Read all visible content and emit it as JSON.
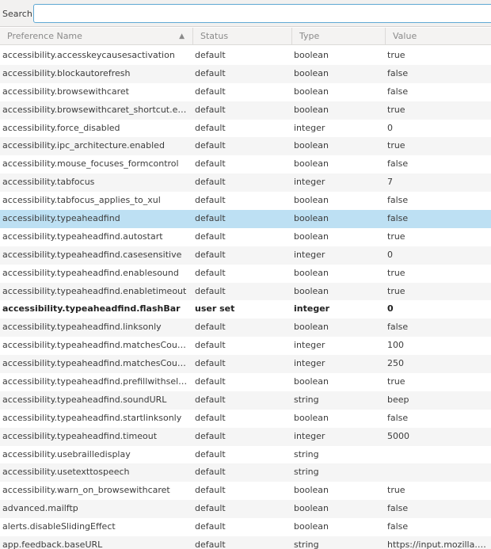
{
  "search": {
    "label": "Search:",
    "value": "",
    "placeholder": ""
  },
  "columns": {
    "name": "Preference Name",
    "status": "Status",
    "type": "Type",
    "value": "Value"
  },
  "rows": [
    {
      "name": "accessibility.accesskeycausesactivation",
      "status": "default",
      "type": "boolean",
      "value": "true"
    },
    {
      "name": "accessibility.blockautorefresh",
      "status": "default",
      "type": "boolean",
      "value": "false"
    },
    {
      "name": "accessibility.browsewithcaret",
      "status": "default",
      "type": "boolean",
      "value": "false"
    },
    {
      "name": "accessibility.browsewithcaret_shortcut.enabled",
      "status": "default",
      "type": "boolean",
      "value": "true"
    },
    {
      "name": "accessibility.force_disabled",
      "status": "default",
      "type": "integer",
      "value": "0"
    },
    {
      "name": "accessibility.ipc_architecture.enabled",
      "status": "default",
      "type": "boolean",
      "value": "true"
    },
    {
      "name": "accessibility.mouse_focuses_formcontrol",
      "status": "default",
      "type": "boolean",
      "value": "false"
    },
    {
      "name": "accessibility.tabfocus",
      "status": "default",
      "type": "integer",
      "value": "7"
    },
    {
      "name": "accessibility.tabfocus_applies_to_xul",
      "status": "default",
      "type": "boolean",
      "value": "false"
    },
    {
      "name": "accessibility.typeaheadfind",
      "status": "default",
      "type": "boolean",
      "value": "false"
    },
    {
      "name": "accessibility.typeaheadfind.autostart",
      "status": "default",
      "type": "boolean",
      "value": "true"
    },
    {
      "name": "accessibility.typeaheadfind.casesensitive",
      "status": "default",
      "type": "integer",
      "value": "0"
    },
    {
      "name": "accessibility.typeaheadfind.enablesound",
      "status": "default",
      "type": "boolean",
      "value": "true"
    },
    {
      "name": "accessibility.typeaheadfind.enabletimeout",
      "status": "default",
      "type": "boolean",
      "value": "true"
    },
    {
      "name": "accessibility.typeaheadfind.flashBar",
      "status": "user set",
      "type": "integer",
      "value": "0"
    },
    {
      "name": "accessibility.typeaheadfind.linksonly",
      "status": "default",
      "type": "boolean",
      "value": "false"
    },
    {
      "name": "accessibility.typeaheadfind.matchesCountLimit",
      "status": "default",
      "type": "integer",
      "value": "100"
    },
    {
      "name": "accessibility.typeaheadfind.matchesCountTime...",
      "status": "default",
      "type": "integer",
      "value": "250"
    },
    {
      "name": "accessibility.typeaheadfind.prefillwithselection",
      "status": "default",
      "type": "boolean",
      "value": "true"
    },
    {
      "name": "accessibility.typeaheadfind.soundURL",
      "status": "default",
      "type": "string",
      "value": "beep"
    },
    {
      "name": "accessibility.typeaheadfind.startlinksonly",
      "status": "default",
      "type": "boolean",
      "value": "false"
    },
    {
      "name": "accessibility.typeaheadfind.timeout",
      "status": "default",
      "type": "integer",
      "value": "5000"
    },
    {
      "name": "accessibility.usebrailledisplay",
      "status": "default",
      "type": "string",
      "value": ""
    },
    {
      "name": "accessibility.usetexttospeech",
      "status": "default",
      "type": "string",
      "value": ""
    },
    {
      "name": "accessibility.warn_on_browsewithcaret",
      "status": "default",
      "type": "boolean",
      "value": "true"
    },
    {
      "name": "advanced.mailftp",
      "status": "default",
      "type": "boolean",
      "value": "false"
    },
    {
      "name": "alerts.disableSlidingEffect",
      "status": "default",
      "type": "boolean",
      "value": "false"
    },
    {
      "name": "app.feedback.baseURL",
      "status": "default",
      "type": "string",
      "value": "https://input.mozilla.org/%"
    }
  ],
  "selected_row": 9,
  "colors": {
    "selected": "#bde0f3",
    "focus_border": "#5fa8d3"
  }
}
